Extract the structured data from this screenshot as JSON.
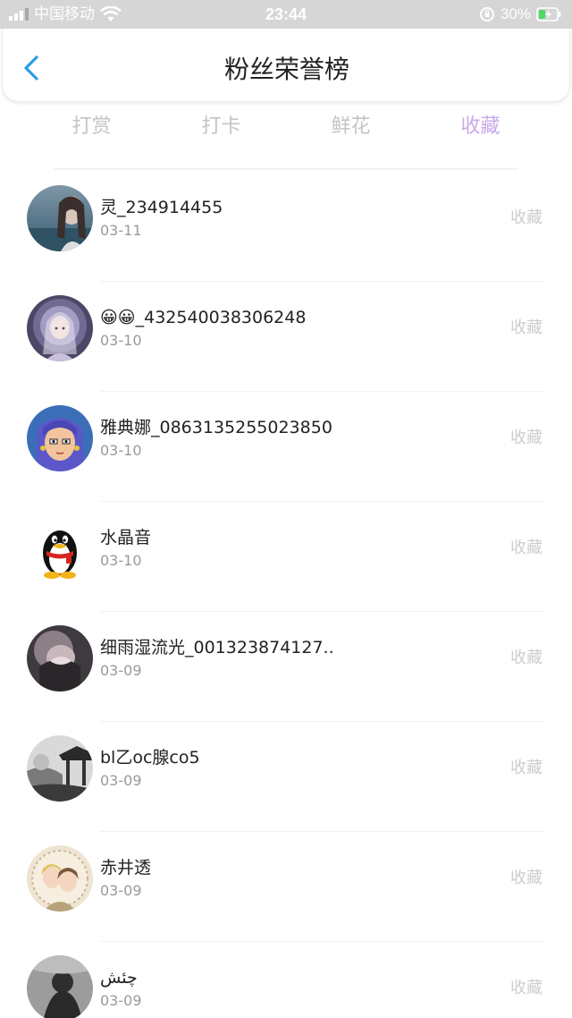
{
  "status_bar": {
    "carrier": "中国移动",
    "time": "23:44",
    "battery_percent": "30%"
  },
  "nav": {
    "title": "粉丝荣誉榜",
    "back_icon": "chevron-left-icon"
  },
  "tabs": [
    {
      "label": "打赏",
      "active": false
    },
    {
      "label": "打卡",
      "active": false
    },
    {
      "label": "鲜花",
      "active": false
    },
    {
      "label": "收藏",
      "active": true
    }
  ],
  "colors": {
    "accent_tab": "#c9a8e8",
    "back_icon": "#2f9be6",
    "muted": "#cdcdcd"
  },
  "fans": [
    {
      "name": "灵_234914455",
      "date": "03-11",
      "action": "收藏",
      "avatar": "avatar-photo-girl"
    },
    {
      "name": "😀😀_432540038306248",
      "date": "03-10",
      "action": "收藏",
      "avatar": "avatar-anime-purple"
    },
    {
      "name": "雅典娜_0863135255023850",
      "date": "03-10",
      "action": "收藏",
      "avatar": "avatar-cartoon-athena"
    },
    {
      "name": "水晶音",
      "date": "03-10",
      "action": "收藏",
      "avatar": "avatar-penguin"
    },
    {
      "name": "细雨湿流光_001323874127...",
      "date": "03-09",
      "action": "收藏",
      "avatar": "avatar-dark-rose"
    },
    {
      "name": "bl乙oc腺co5",
      "date": "03-09",
      "action": "收藏",
      "avatar": "avatar-pavilion-ink"
    },
    {
      "name": "赤井透",
      "date": "03-09",
      "action": "收藏",
      "avatar": "avatar-anime-couple"
    },
    {
      "name": "چئش",
      "date": "03-09",
      "action": "收藏",
      "avatar": "avatar-grey-figure"
    }
  ]
}
